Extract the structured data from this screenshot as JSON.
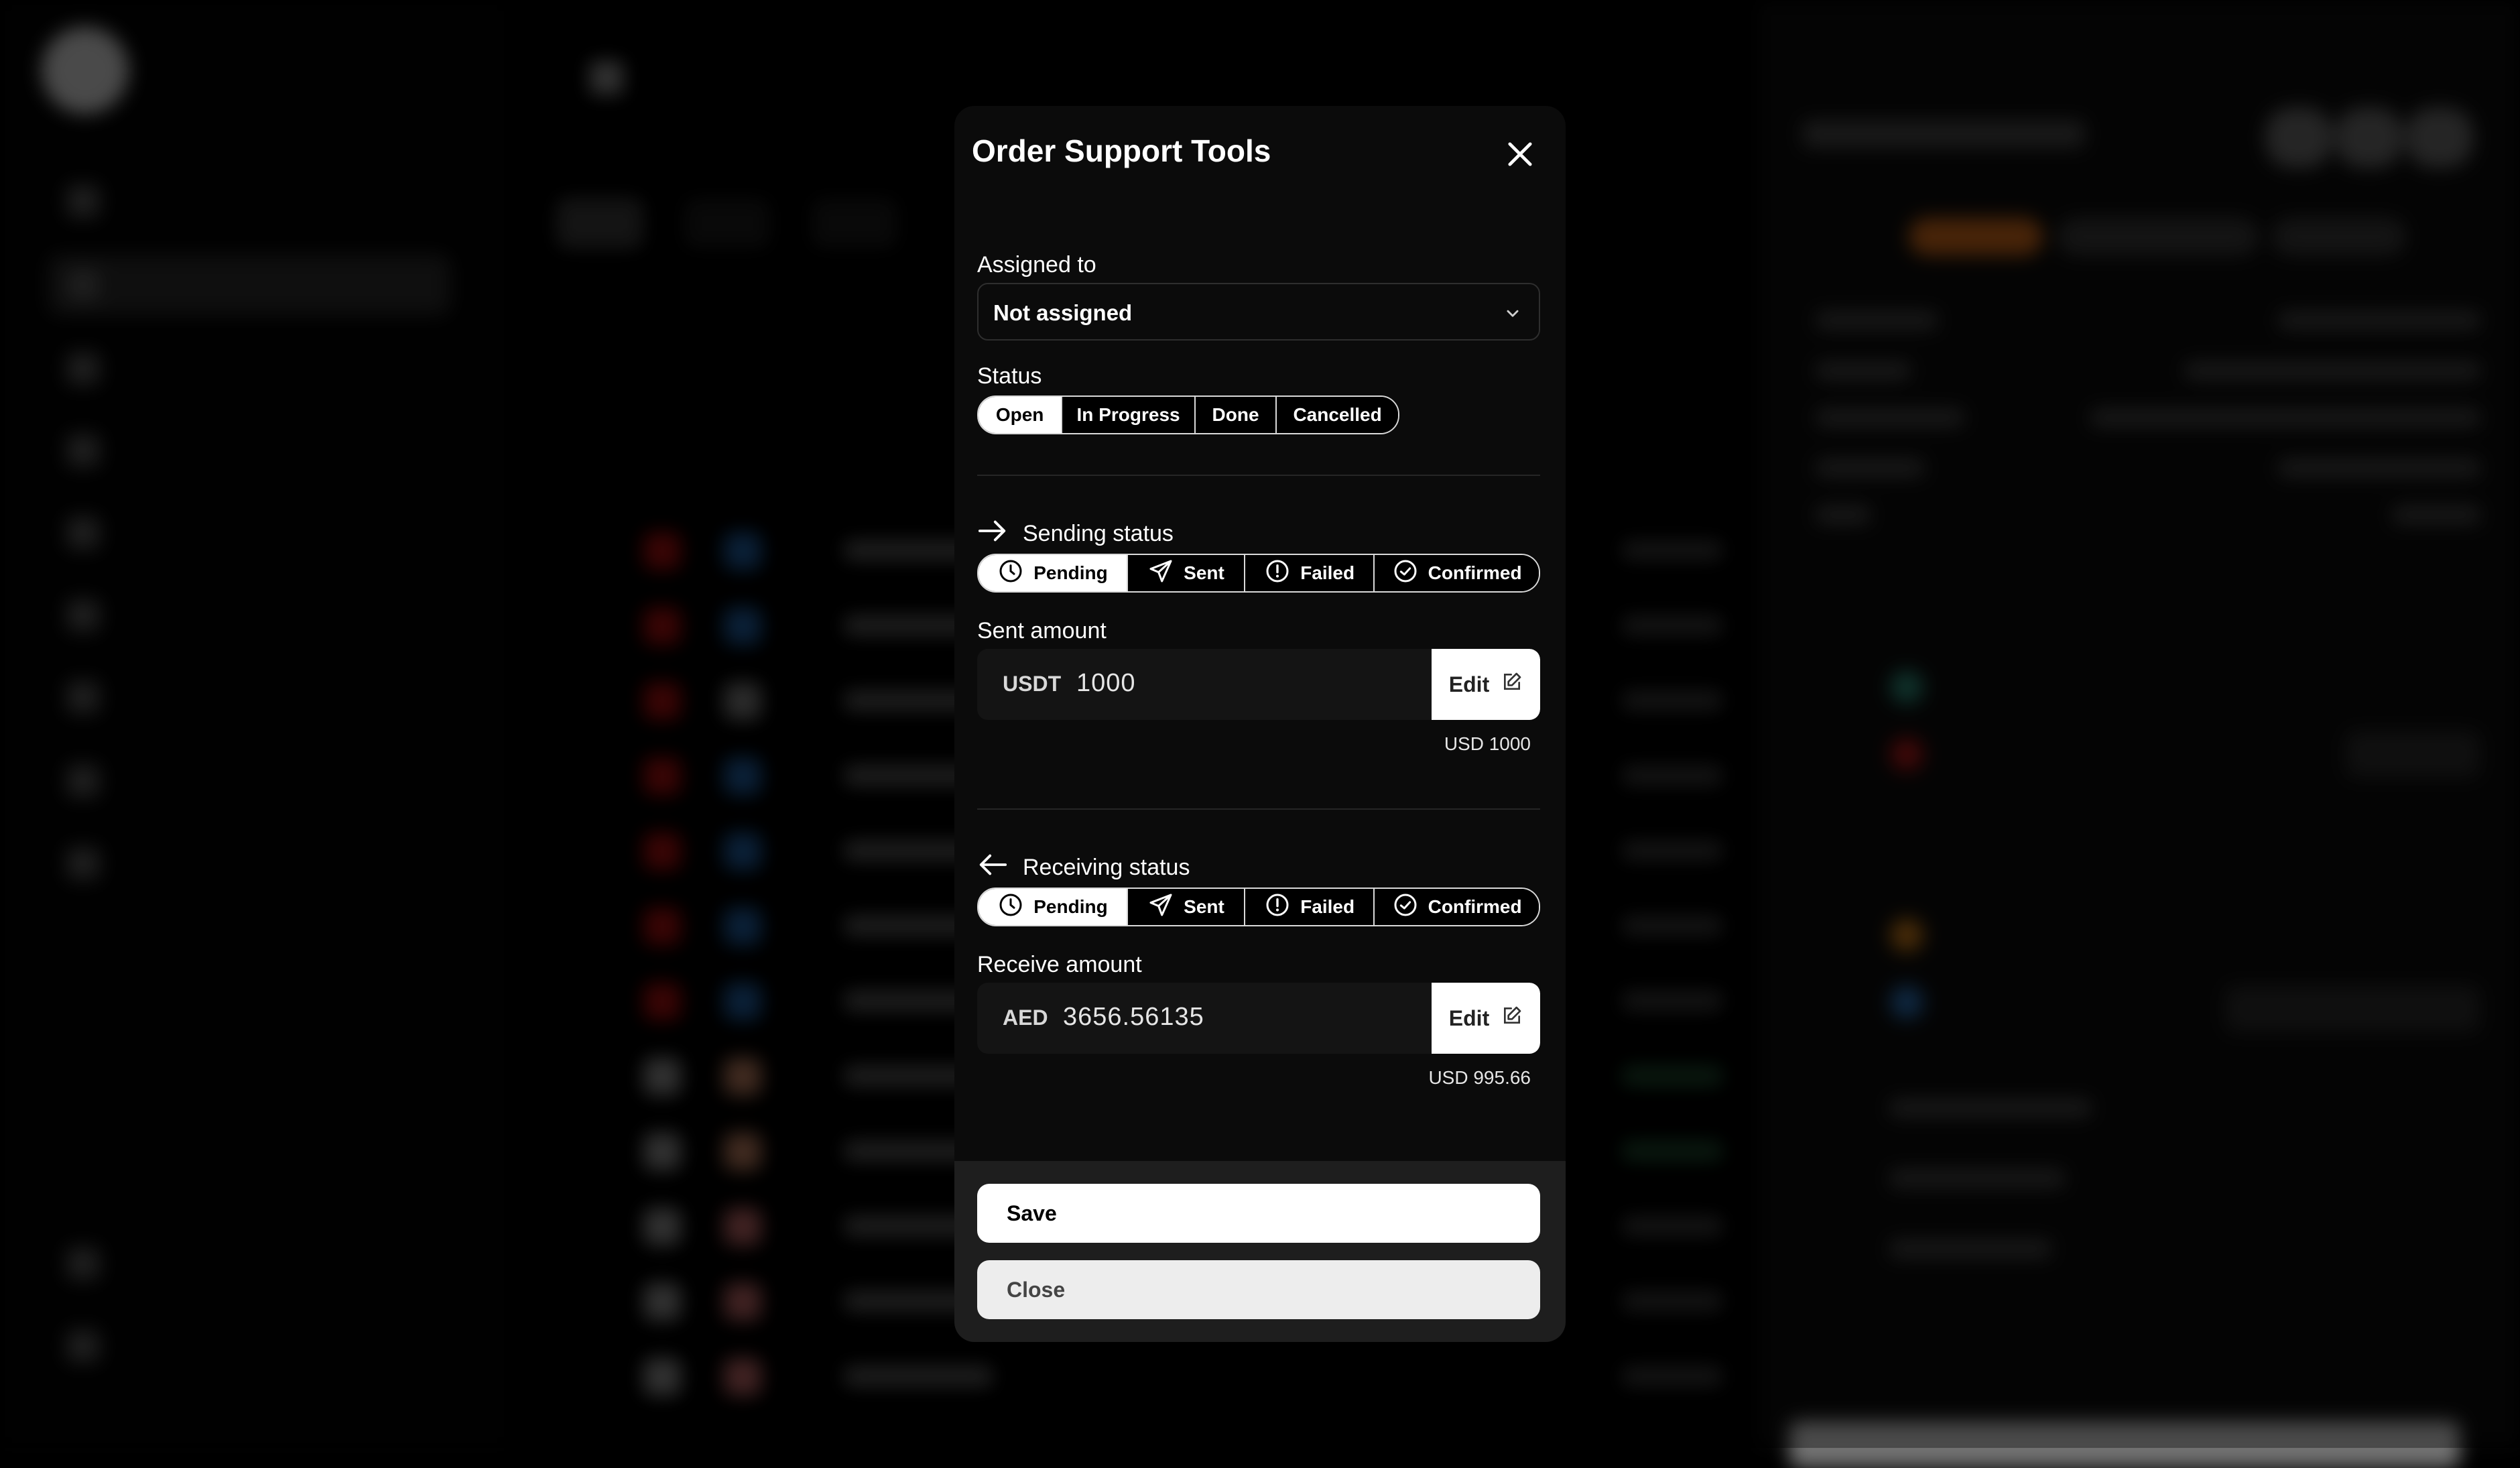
{
  "modal": {
    "title": "Order Support Tools",
    "assigned_label": "Assigned to",
    "assigned_value": "Not assigned",
    "status_label": "Status",
    "status_options": [
      "Open",
      "In Progress",
      "Done",
      "Cancelled"
    ],
    "status_selected": "Open",
    "sending": {
      "label": "Sending status",
      "options": [
        "Pending",
        "Sent",
        "Failed",
        "Confirmed"
      ],
      "selected": "Pending",
      "amount_label": "Sent amount",
      "currency": "USDT",
      "amount": "1000",
      "edit_label": "Edit",
      "usd_note": "USD 1000"
    },
    "receiving": {
      "label": "Receiving status",
      "options": [
        "Pending",
        "Sent",
        "Failed",
        "Confirmed"
      ],
      "selected": "Pending",
      "amount_label": "Receive amount",
      "currency": "AED",
      "amount": "3656.56135",
      "edit_label": "Edit",
      "usd_note": "USD 995.66"
    },
    "save_label": "Save",
    "close_label": "Close"
  }
}
